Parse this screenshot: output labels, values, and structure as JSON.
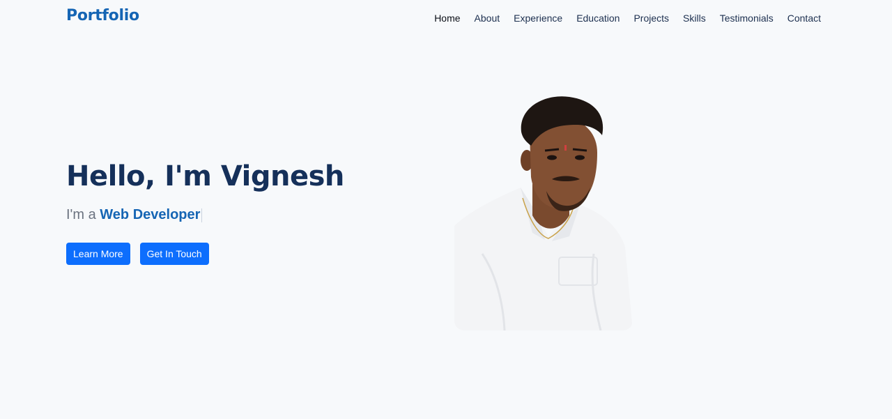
{
  "nav": {
    "brand": "Portfolio",
    "links": [
      "Home",
      "About",
      "Experience",
      "Education",
      "Projects",
      "Skills",
      "Testimonials",
      "Contact"
    ],
    "active": "Home"
  },
  "hero": {
    "greeting": "Hello, I'm Vignesh",
    "subtitle_prefix": "I'm a ",
    "role": "Web Developer",
    "buttons": {
      "learn_more": "Learn More",
      "get_in_touch": "Get In Touch"
    }
  },
  "colors": {
    "background": "#f7f9fb",
    "brand": "#1565b4",
    "heading": "#15305a",
    "button": "#0d6efd"
  }
}
